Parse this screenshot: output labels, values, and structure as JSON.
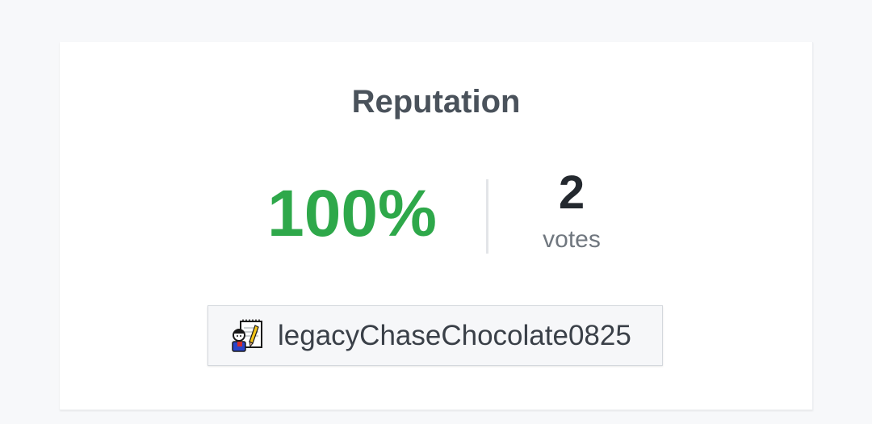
{
  "reputation": {
    "title": "Reputation",
    "percent": "100%",
    "votes_count": "2",
    "votes_label": "votes",
    "percent_color": "#2ea84a"
  },
  "user": {
    "username": "legacyChaseChocolate0825",
    "avatar_icon": "notepad-writer-icon"
  }
}
